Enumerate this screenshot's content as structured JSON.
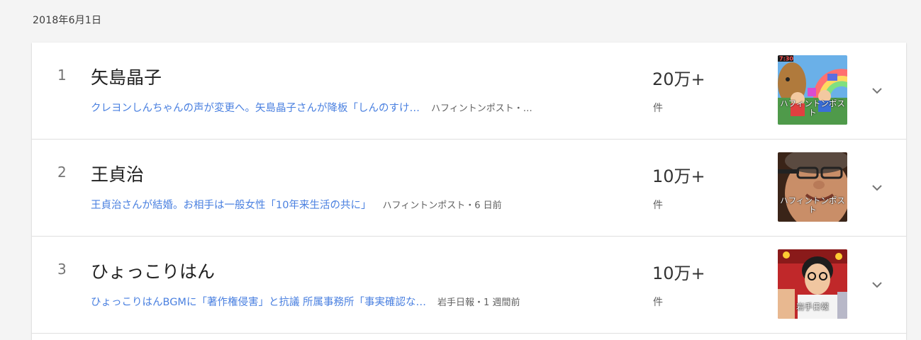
{
  "date_header": "2018年6月1日",
  "trends": [
    {
      "rank": "1",
      "title": "矢島晶子",
      "article": "クレヨンしんちゃんの声が変更へ。矢島晶子さんが降板「しんのすけ…",
      "source": "ハフィントンポスト・…",
      "count": "20万+",
      "count_unit": "件",
      "thumb_caption": "ハフィントンポスト",
      "thumb_time": "7:30"
    },
    {
      "rank": "2",
      "title": "王貞治",
      "article": "王貞治さんが結婚。お相手は一般女性「10年来生活の共に」",
      "source": "ハフィントンポスト・6 日前",
      "count": "10万+",
      "count_unit": "件",
      "thumb_caption": "ハフィントンポスト"
    },
    {
      "rank": "3",
      "title": "ひょっこりはん",
      "article": "ひょっこりはんBGMに「著作権侵害」と抗議 所属事務所「事実確認な…",
      "source": "岩手日報・1 週間前",
      "count": "10万+",
      "count_unit": "件",
      "thumb_caption": "岩手日報"
    }
  ],
  "icons": {
    "expand": "chevron-down-icon"
  },
  "colors": {
    "link": "#4a80e0",
    "background": "#f4f4f4",
    "card": "#ffffff"
  }
}
